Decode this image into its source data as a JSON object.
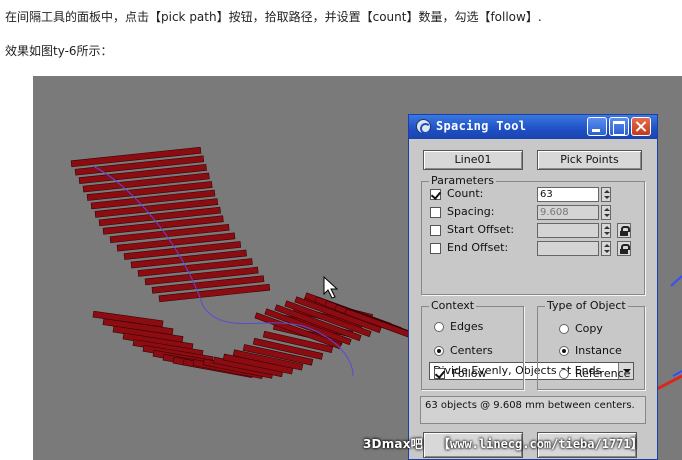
{
  "article": {
    "paragraph1": "在间隔工具的面板中，点击【pick path】按钮，拾取路径，并设置【count】数量，勾选【follow】.",
    "paragraph2": "效果如图ty-6所示："
  },
  "dialog": {
    "title": "Spacing Tool",
    "path_button": "Line01",
    "pick_points_button": "Pick Points",
    "parameters": {
      "group_label": "Parameters",
      "count_label": "Count:",
      "count_value": "63",
      "count_checked": true,
      "spacing_label": "Spacing:",
      "spacing_value": "9.608",
      "spacing_checked": false,
      "start_offset_label": "Start Offset:",
      "start_offset_checked": false,
      "end_offset_label": "End Offset:",
      "end_offset_checked": false,
      "distribution_selected": "Divide Evenly, Objects at Ends"
    },
    "context": {
      "group_label": "Context",
      "edges_label": "Edges",
      "centers_label": "Centers",
      "centers_selected": true,
      "follow_label": "Follow",
      "follow_checked": true
    },
    "type_of_object": {
      "group_label": "Type of Object",
      "copy_label": "Copy",
      "instance_label": "Instance",
      "instance_selected": true,
      "reference_label": "Reference"
    },
    "status_text": "63 objects @ 9.608 mm between centers."
  },
  "watermark": {
    "left": "3Dmax吧",
    "right": "【www.linecg.com/tieba/1771】"
  },
  "colors": {
    "slat": "#8b0d12",
    "viewport_bg": "#7a7a7a",
    "title_bar": "#1f4fc4"
  }
}
